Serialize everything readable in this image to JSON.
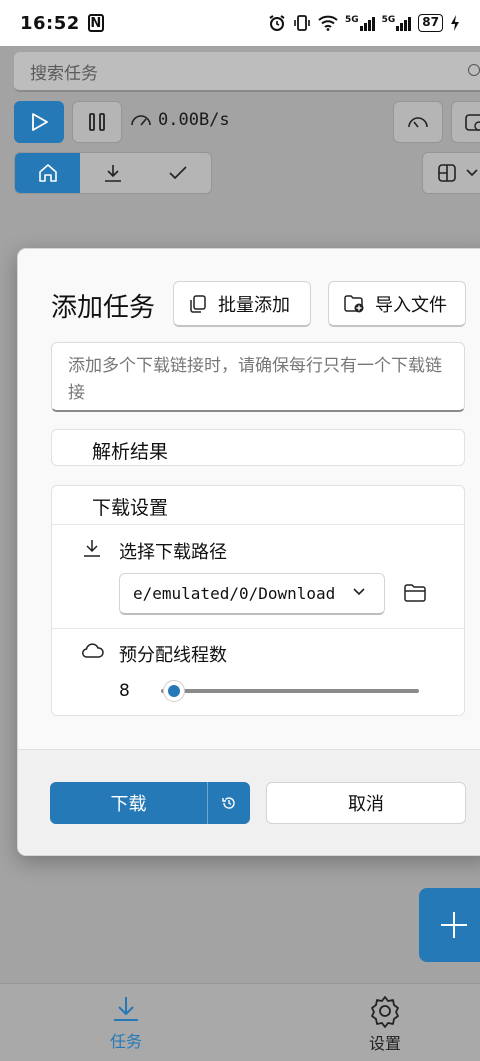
{
  "status_bar": {
    "time": "16:52",
    "nfc_icon": "N",
    "battery": "87"
  },
  "search": {
    "placeholder": "搜索任务"
  },
  "toolbar": {
    "speed": "0.00B/s"
  },
  "dialog": {
    "title": "添加任务",
    "batch_add_label": "批量添加",
    "import_file_label": "导入文件",
    "links_placeholder": "添加多个下载链接时，请确保每行只有一个下载链接",
    "parse_results_title": "解析结果",
    "download_settings_title": "下载设置",
    "choose_path_label": "选择下载路径",
    "path_value": "e/emulated/0/Download",
    "threads_label": "预分配线程数",
    "threads_value": "8",
    "threads_level": 0.05,
    "download_label": "下载",
    "cancel_label": "取消"
  },
  "bottom_nav": {
    "tasks_label": "任务",
    "settings_label": "设置"
  },
  "colors": {
    "accent": "#2579b7",
    "scrim": "#a3a3a3",
    "dialog_bg": "#f9f9f9"
  }
}
